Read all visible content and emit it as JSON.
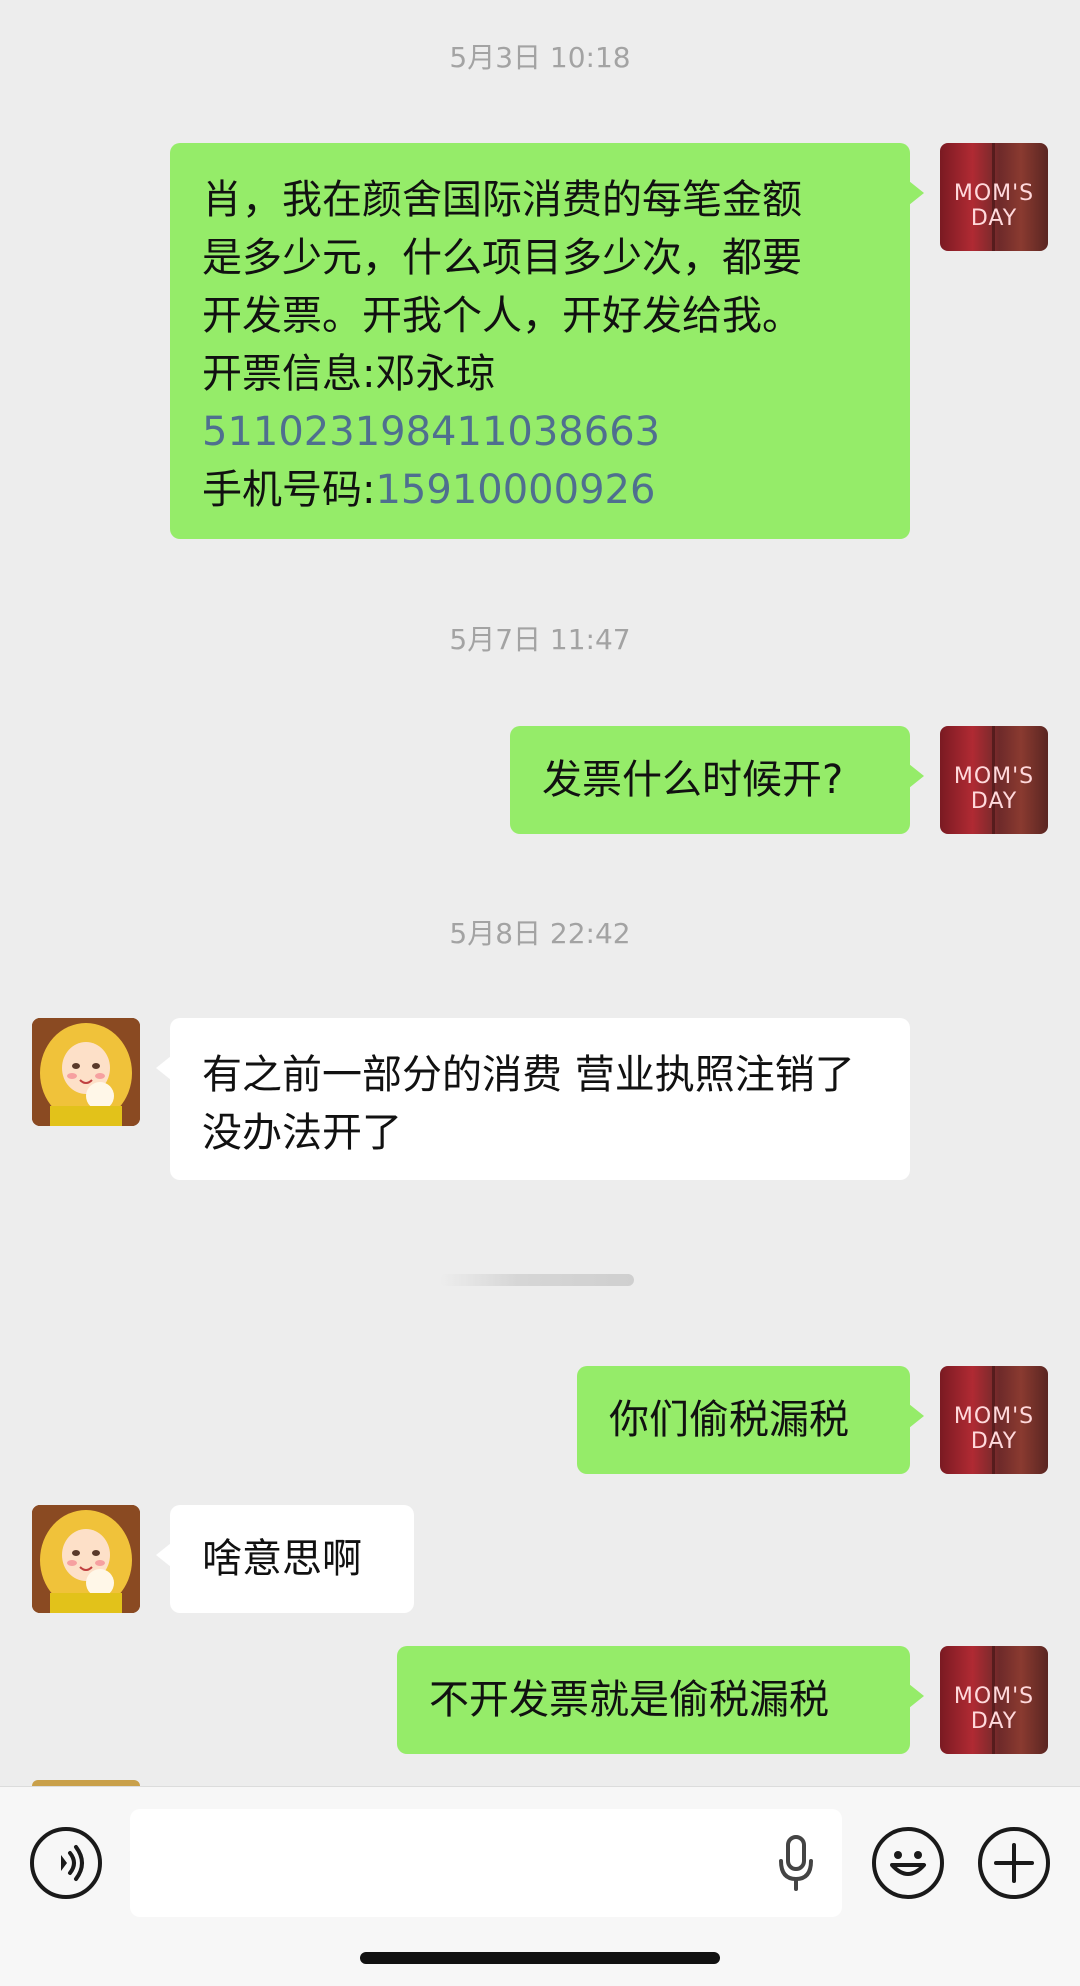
{
  "messages": [
    {
      "type": "timestamp",
      "text": "5月3日 10:18"
    },
    {
      "type": "message",
      "sender": "me",
      "text_line1": "肖，我在颜舍国际消费的每笔金额",
      "text_line2": "是多少元，什么项目多少次，都要",
      "text_line3": "开发票。开我个人，开好发给我。",
      "text_line4": "开票信息:邓永琼",
      "id_number": "511023198411038663",
      "phone_label": "手机号码:",
      "phone_number": "15910000926"
    },
    {
      "type": "timestamp",
      "text": "5月7日 11:47"
    },
    {
      "type": "message",
      "sender": "me",
      "text": "发票什么时候开?"
    },
    {
      "type": "timestamp",
      "text": "5月8日 22:42"
    },
    {
      "type": "message",
      "sender": "other",
      "text": "有之前一部分的消费 营业执照注销了  没办法开了"
    },
    {
      "type": "message",
      "sender": "me",
      "text": "你们偷税漏税"
    },
    {
      "type": "message",
      "sender": "other",
      "text": "啥意思啊"
    },
    {
      "type": "message",
      "sender": "me",
      "text": "不开发票就是偷税漏税"
    }
  ],
  "avatars": {
    "me_logo_text": "MOM'S DAY"
  },
  "composer": {
    "icons": [
      "voice-icon",
      "microphone-icon",
      "emoji-icon",
      "plus-icon"
    ],
    "input_value": ""
  },
  "colors": {
    "background": "#ededed",
    "my_bubble": "#95ec69",
    "their_bubble": "#ffffff",
    "timestamp_text": "#a3a3a3",
    "number_link": "#4f6f8f"
  }
}
